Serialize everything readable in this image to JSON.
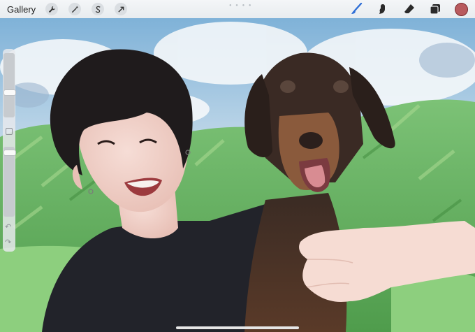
{
  "toolbar": {
    "gallery_label": "Gallery",
    "left_tools": [
      "wrench-icon",
      "magic-wand-icon",
      "selection-s-icon",
      "transform-arrow-icon"
    ],
    "right_tools": [
      "brush-icon",
      "smudge-icon",
      "eraser-icon",
      "layers-icon"
    ],
    "brush_active_color": "#2f6fd6",
    "current_color": "#b85a5e"
  },
  "sidebar": {
    "brush_size_level": 0.45,
    "opacity_level": 0.1
  },
  "canvas": {
    "subject": "digital painting of a young man with a dog in a green landscape"
  }
}
